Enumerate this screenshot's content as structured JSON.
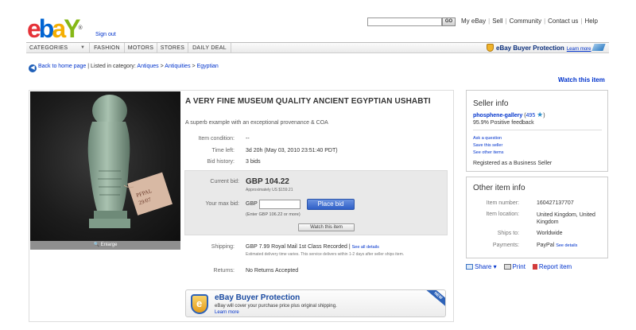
{
  "header": {
    "sign_out": "Sign out",
    "search_go": "GO",
    "top_links": [
      "My eBay",
      "Sell",
      "Community",
      "Contact us",
      "Help"
    ]
  },
  "nav": {
    "categories": "CATEGORIES",
    "fashion": "FASHION",
    "motors": "MOTORS",
    "stores": "STORES",
    "daily_deal": "DAILY DEAL",
    "buyer_protection": "eBay Buyer Protection",
    "learn_more": "Learn more"
  },
  "breadcrumb": {
    "back": "Back to home page",
    "listed_in": "| Listed in category:",
    "cat1": "Antiques",
    "sep": ">",
    "cat2": "Antiquities",
    "cat3": "Egyptian"
  },
  "watch_top": "Watch this item",
  "item": {
    "title": "A VERY FINE MUSEUM QUALITY ANCIENT EGYPTIAN USHABTI",
    "subtitle": "A superb example with an exceptional provenance & COA",
    "enlarge": "Enlarge",
    "condition_label": "Item condition:",
    "condition_value": "--",
    "time_left_label": "Time left:",
    "time_left_value": "3d 20h (May 03, 2010 23:51:40 PDT)",
    "bid_history_label": "Bid history:",
    "bid_history_value": "3 bids",
    "current_bid_label": "Current bid:",
    "current_bid_value": "GBP 104.22",
    "approx": "Approximately US $159.21",
    "max_bid_label": "Your max bid:",
    "currency": "GBP",
    "place_bid": "Place bid",
    "enter_hint": "(Enter GBP 106.22 or more)",
    "watch_btn": "Watch this item",
    "shipping_label": "Shipping:",
    "shipping_value": "GBP 7.99 Royal Mail 1st Class Recorded",
    "shipping_sep": "|",
    "see_all": "See all details",
    "shipping_detail": "Estimated delivery time varies. This service delivers within 1-2 days after seller ships item.",
    "returns_label": "Returns:",
    "returns_value": "No Returns Accepted"
  },
  "bbp": {
    "title": "eBay Buyer Protection",
    "desc": "eBay will cover your purchase price plus original shipping.",
    "learn": "Learn more",
    "ribbon": "NEW"
  },
  "seller": {
    "heading": "Seller info",
    "name": "phosphene-gallery",
    "score_open": "(",
    "score": "495",
    "score_close": ")",
    "positive": "95.9% Positive feedback",
    "ask": "Ask a question",
    "save": "Save this seller",
    "see_other": "See other items",
    "registered": "Registered as a Business Seller"
  },
  "other": {
    "heading": "Other item info",
    "item_number_label": "Item number:",
    "item_number": "160427137707",
    "location_label": "Item location:",
    "location": "United Kingdom, United Kingdom",
    "ships_label": "Ships to:",
    "ships": "Worldwide",
    "payments_label": "Payments:",
    "payments": "PayPal",
    "see_details": "See details"
  },
  "actions": {
    "share": "Share",
    "print": "Print",
    "report": "Report item"
  },
  "colors": {
    "link": "#0033cc",
    "bid_button": "#2f5fc7",
    "bid_box_bg": "#e9e9e9",
    "photo_bg": "#1c1c1c"
  }
}
